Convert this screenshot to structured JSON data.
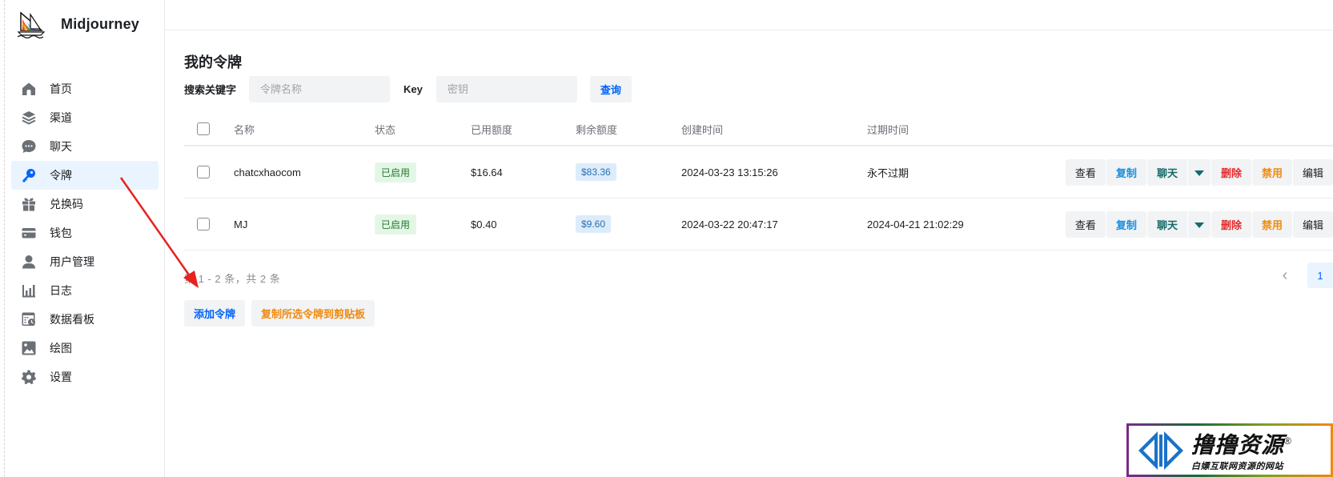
{
  "app": {
    "name": "Midjourney",
    "logo_icon": "sailboat-logo-icon"
  },
  "sidebar": {
    "items": [
      {
        "label": "首页",
        "icon": "home-icon",
        "active": false
      },
      {
        "label": "渠道",
        "icon": "layers-icon",
        "active": false
      },
      {
        "label": "聊天",
        "icon": "chat-bubble-icon",
        "active": false
      },
      {
        "label": "令牌",
        "icon": "key-icon",
        "active": true
      },
      {
        "label": "兑换码",
        "icon": "gift-icon",
        "active": false
      },
      {
        "label": "钱包",
        "icon": "credit-card-icon",
        "active": false
      },
      {
        "label": "用户管理",
        "icon": "user-icon",
        "active": false
      },
      {
        "label": "日志",
        "icon": "bar-chart-icon",
        "active": false
      },
      {
        "label": "数据看板",
        "icon": "dashboard-icon",
        "active": false
      },
      {
        "label": "绘图",
        "icon": "image-icon",
        "active": false
      },
      {
        "label": "设置",
        "icon": "gear-icon",
        "active": false
      }
    ]
  },
  "page": {
    "title": "我的令牌",
    "search": {
      "keyword_label": "搜索关键字",
      "name_placeholder": "令牌名称",
      "name_value": "",
      "key_label": "Key",
      "key_placeholder": "密钥",
      "key_value": "",
      "query_button": "查询"
    },
    "table": {
      "columns": [
        "名称",
        "状态",
        "已用额度",
        "剩余额度",
        "创建时间",
        "过期时间"
      ],
      "rows": [
        {
          "name": "chatcxhaocom",
          "status": "已启用",
          "used": "$16.64",
          "remaining": "$83.36",
          "created": "2024-03-23 13:15:26",
          "expires": "永不过期"
        },
        {
          "name": "MJ",
          "status": "已启用",
          "used": "$0.40",
          "remaining": "$9.60",
          "created": "2024-03-22 20:47:17",
          "expires": "2024-04-21 21:02:29"
        }
      ],
      "row_actions": {
        "view": "查看",
        "copy": "复制",
        "chat": "聊天",
        "delete": "删除",
        "disable": "禁用",
        "edit": "编辑"
      }
    },
    "pagination": {
      "info": "第 1 - 2 条，共 2 条",
      "current_page": "1"
    },
    "buttons": {
      "add_token": "添加令牌",
      "copy_selected": "复制所选令牌到剪贴板"
    }
  },
  "watermark": {
    "title": "撸撸资源",
    "registered": "®",
    "subtitle": "白嫖互联网资源的网站"
  },
  "colors": {
    "accent": "#0064fa",
    "active_bg": "#eaf4fe",
    "copy": "#1a8fe0",
    "chat": "#136c6a",
    "delete": "#e42b2b",
    "disable": "#f08a10",
    "status_enabled_bg": "#e4f7e6",
    "remaining_bg": "#dcecfb",
    "annotation_arrow": "#e8221f"
  }
}
